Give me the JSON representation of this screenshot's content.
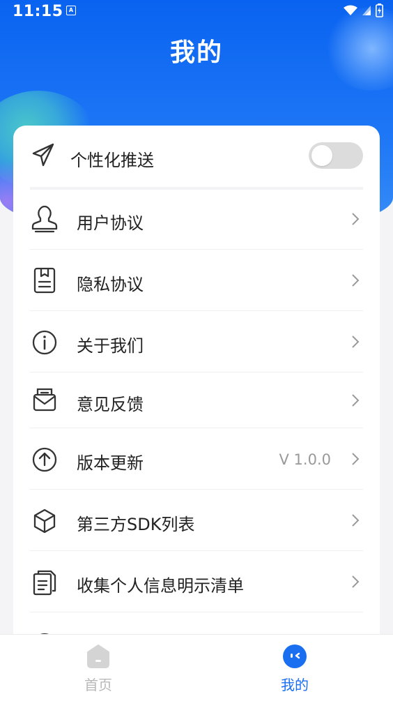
{
  "status_bar": {
    "time": "11:15",
    "notif_glyph": "A"
  },
  "page_title": "我的",
  "push": {
    "label": "个性化推送",
    "enabled": false
  },
  "menu": [
    {
      "label": "用户协议",
      "icon": "stamp-icon"
    },
    {
      "label": "隐私协议",
      "icon": "document-icon"
    },
    {
      "label": "关于我们",
      "icon": "info-icon"
    },
    {
      "label": "意见反馈",
      "icon": "mail-icon"
    },
    {
      "label": "版本更新",
      "icon": "upload-icon",
      "value": "V 1.0.0"
    },
    {
      "label": "第三方SDK列表",
      "icon": "cube-icon"
    },
    {
      "label": "收集个人信息明示清单",
      "icon": "copy-icon"
    }
  ],
  "tabs": [
    {
      "label": "首页",
      "active": false,
      "color": "#b8b8b8"
    },
    {
      "label": "我的",
      "active": true,
      "color": "#1a6ff0"
    }
  ],
  "colors": {
    "brand": "#1a6ff0"
  }
}
